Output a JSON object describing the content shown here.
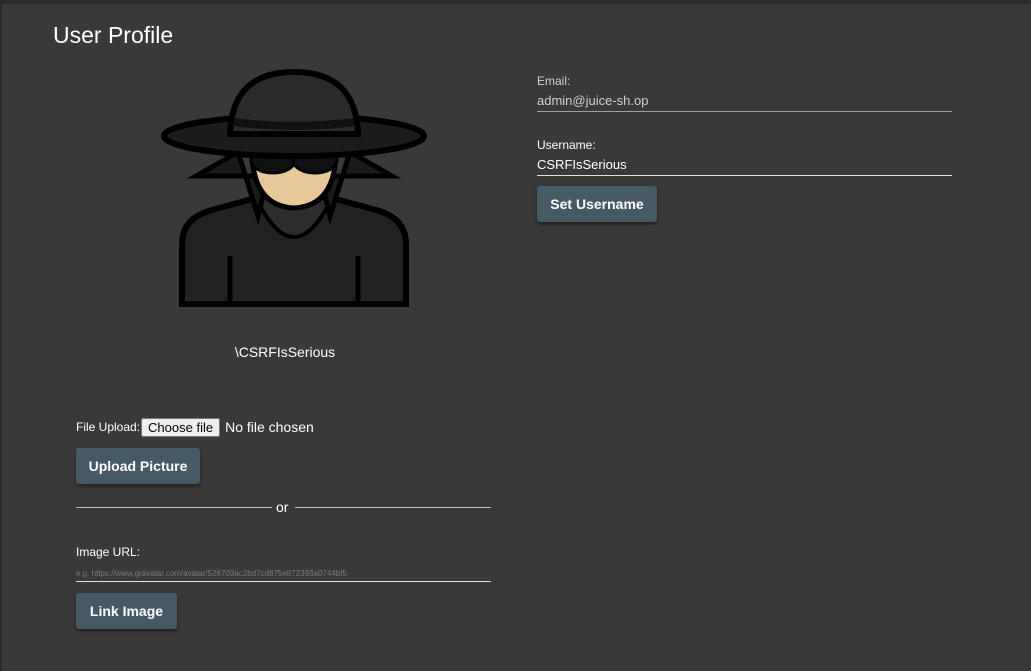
{
  "page": {
    "title": "User Profile"
  },
  "profile": {
    "display_name": "\\CSRFIsSerious"
  },
  "upload": {
    "label": "File Upload:",
    "choose_file": "Choose file",
    "status": "No file chosen",
    "button": "Upload Picture"
  },
  "divider": {
    "text": "or"
  },
  "image_url": {
    "label": "Image URL:",
    "placeholder": "e.g. https://www.gravatar.com/avatar/526703ac2bd7cd875e872393a0744bf5",
    "button": "Link Image"
  },
  "account": {
    "email_label": "Email:",
    "email_value": "admin@juice-sh.op",
    "username_label": "Username:",
    "username_value": "CSRFIsSerious",
    "set_username_button": "Set Username"
  },
  "colors": {
    "background": "#393939",
    "button": "#455a64",
    "text": "#ffffff"
  },
  "icons": {
    "avatar": "spy-avatar-icon"
  }
}
